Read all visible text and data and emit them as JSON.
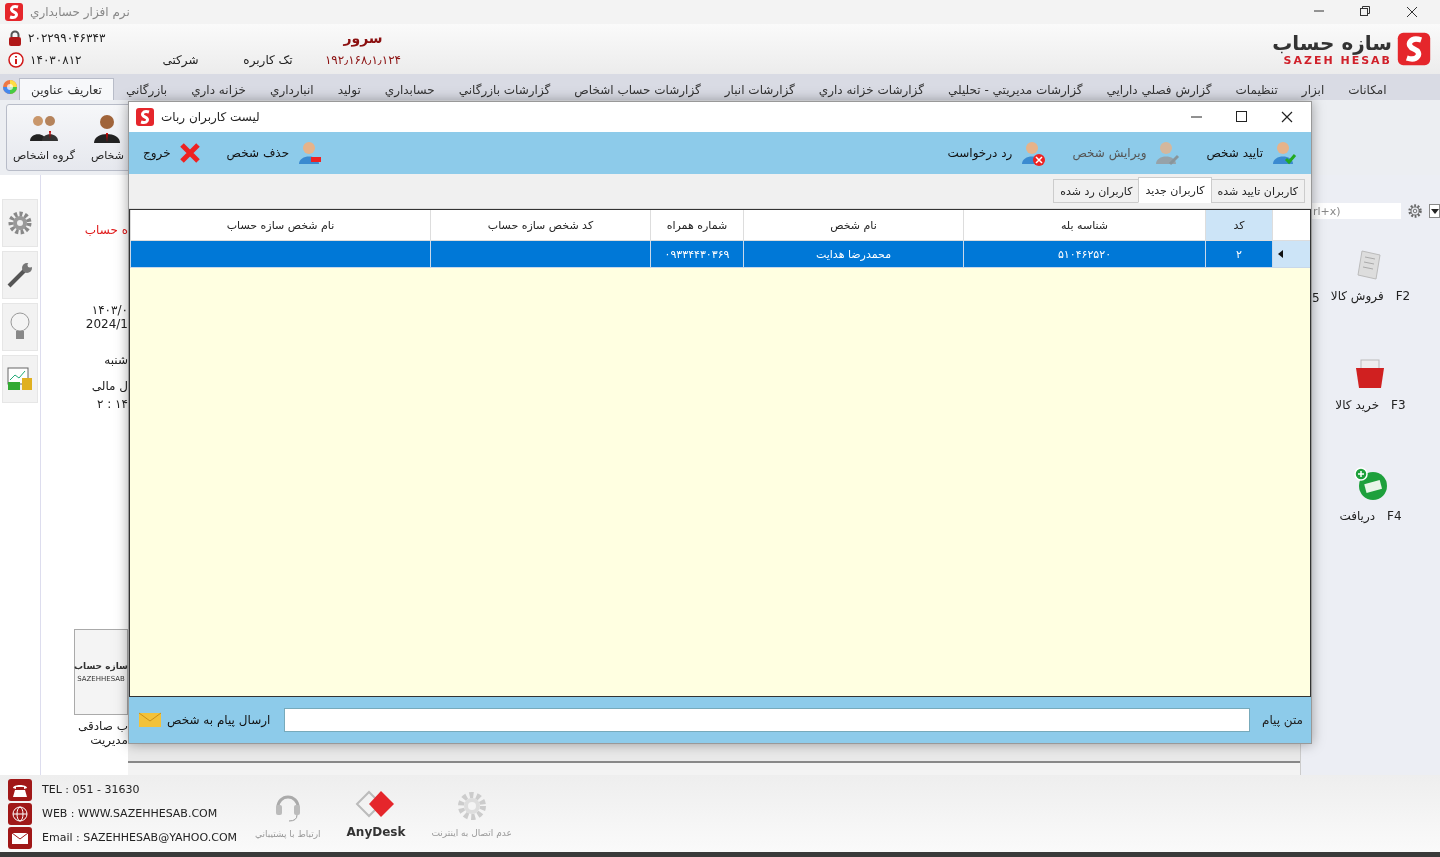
{
  "window": {
    "title": "نرم افزار حسابداري"
  },
  "header": {
    "serial": "۲۰۲۲۹۹۰۴۶۳۴۳",
    "version": "۱۴۰۳۰۸۱۲",
    "license_type": "شرکتی",
    "user_mode": "تک کاربره",
    "server_label": "سرور",
    "server_ip": "۱۹۲٫۱۶۸٫۱٫۱۲۴",
    "logo": {
      "name": "سازه حساب",
      "latin": "SAZEH HESAB"
    }
  },
  "menu": [
    {
      "label": "امکانات",
      "selected": false
    },
    {
      "label": "ابزار",
      "selected": false
    },
    {
      "label": "تنظیمات",
      "selected": false
    },
    {
      "label": "گزارش فصلي دارايي",
      "selected": false
    },
    {
      "label": "گزارشات مديريتي - تحليلي",
      "selected": false
    },
    {
      "label": "گزارشات خزانه داري",
      "selected": false
    },
    {
      "label": "گزارشات انبار",
      "selected": false
    },
    {
      "label": "گزارشات حساب اشخاص",
      "selected": false
    },
    {
      "label": "گزارشات بازرگاني",
      "selected": false
    },
    {
      "label": "حسابداري",
      "selected": false
    },
    {
      "label": "توليد",
      "selected": false
    },
    {
      "label": "انبارداري",
      "selected": false
    },
    {
      "label": "خزانه داري",
      "selected": false
    },
    {
      "label": "بازرگاني",
      "selected": false
    },
    {
      "label": "تعاريف عناوين",
      "selected": true
    }
  ],
  "ribbon": [
    {
      "label": "شخاص",
      "kind": "person"
    },
    {
      "label": "گروه اشخاص",
      "kind": "group"
    }
  ],
  "home": {
    "title": "ه حساب",
    "date_fa": "۱۴۰۳/۰",
    "date_en": "2024/1",
    "weekday": "شنبه",
    "fiscal": "ل مالی",
    "time": "۲ : ۱۴",
    "logo": {
      "name": "سازه حساب",
      "latin": "SAZEHHESAB"
    },
    "user": "ب صادقی",
    "role": "مدیریت"
  },
  "quick_panel": {
    "search": {
      "placeholder": "rl+x)"
    },
    "column_cut_text": "5",
    "shortcuts": [
      {
        "key": "F2",
        "label": "فروش کالا",
        "kind": "sale"
      },
      {
        "key": "F3",
        "label": "خرید کالا",
        "kind": "purchase"
      },
      {
        "key": "F4",
        "label": "دریافت",
        "kind": "receipt"
      }
    ]
  },
  "footer": {
    "contacts": [
      {
        "kind": "phone",
        "text": "TEL : 051 - 31630"
      },
      {
        "kind": "web",
        "text": "WEB : WWW.SAZEHHESAB.COM"
      },
      {
        "kind": "email",
        "text": "Email : SAZEHHESAB@YAHOO.COM"
      }
    ],
    "support": "ارتباط با پشتيباني",
    "anydesk": "AnyDesk",
    "internet": "عدم اتصال به اينترنت"
  },
  "dialog": {
    "title": "لیست کاربران ربات",
    "toolbar_right": [
      {
        "label": "تایید شخص",
        "kind": "approve",
        "disabled": false
      },
      {
        "label": "ویرایش شخص",
        "kind": "edit",
        "disabled": true
      },
      {
        "label": "رد درخواست",
        "kind": "reject",
        "disabled": false
      }
    ],
    "toolbar_left": [
      {
        "label": "حذف شخص",
        "kind": "delete",
        "disabled": false
      },
      {
        "label": "خروج",
        "kind": "exit",
        "disabled": false
      }
    ],
    "tabs": [
      {
        "label": "کاربران تایید شده",
        "selected": false
      },
      {
        "label": "کاربران جدید",
        "selected": true
      },
      {
        "label": "کاربران رد شده",
        "selected": false
      }
    ],
    "table": {
      "columns": [
        "کد",
        "شناسه بله",
        "نام شخص",
        "شماره همراه",
        "کد شخص سازه حساب",
        "نام شخص سازه حساب"
      ],
      "rows": [
        {
          "cells": [
            "۲",
            "۵۱۰۴۶۲۵۲۰",
            "محمدرضا هدایت",
            "۰۹۳۳۴۴۳۰۳۶۹"
          ],
          "selected": true
        }
      ]
    },
    "message": {
      "label": "متن پیام",
      "send": "ارسال پیام به شخص"
    }
  }
}
